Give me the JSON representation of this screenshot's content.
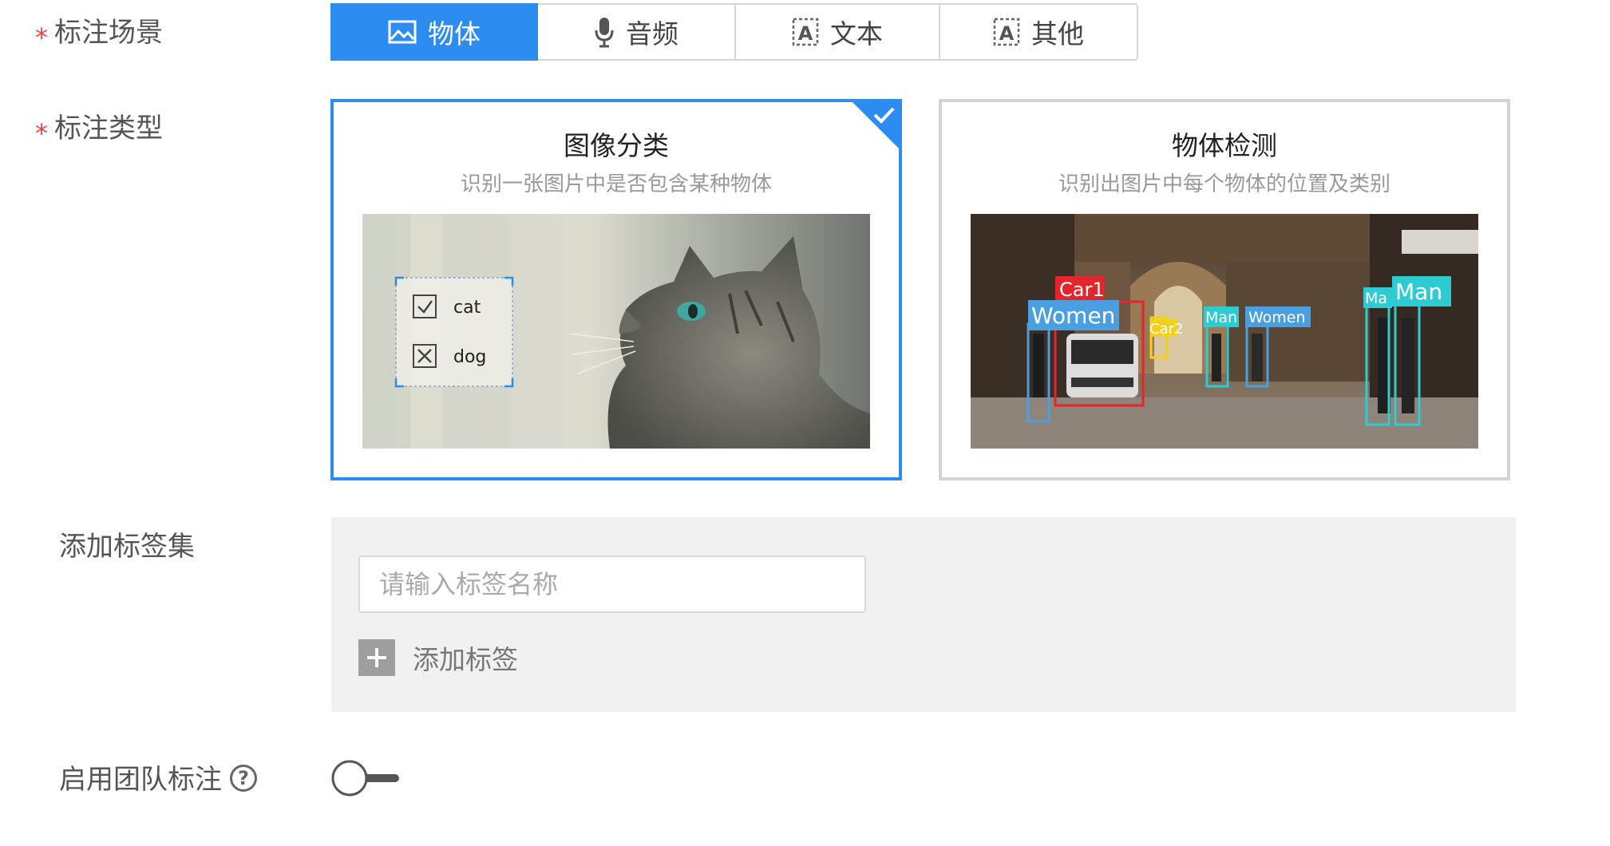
{
  "scene": {
    "label": "标注场景",
    "options": [
      {
        "label": "物体",
        "icon": "image-icon",
        "active": true
      },
      {
        "label": "音频",
        "icon": "microphone-icon",
        "active": false
      },
      {
        "label": "文本",
        "icon": "text-icon",
        "active": false
      },
      {
        "label": "其他",
        "icon": "text-icon",
        "active": false
      }
    ]
  },
  "type": {
    "label": "标注类型",
    "cards": [
      {
        "title": "图像分类",
        "desc": "识别一张图片中是否包含某种物体",
        "selected": true,
        "options": [
          {
            "label": "cat",
            "state": "checked"
          },
          {
            "label": "dog",
            "state": "crossed"
          }
        ]
      },
      {
        "title": "物体检测",
        "desc": "识别出图片中每个物体的位置及类别",
        "selected": false,
        "boxes": [
          "Car1",
          "Women",
          "Car2",
          "Man",
          "Women",
          "Ma",
          "Man"
        ]
      }
    ]
  },
  "tagset": {
    "label": "添加标签集",
    "placeholder": "请输入标签名称",
    "value": "",
    "add_label": "添加标签"
  },
  "team": {
    "label": "启用团队标注",
    "help_symbol": "?",
    "enabled": false
  },
  "colors": {
    "accent": "#2d8cf0",
    "required": "#e64545",
    "panel_bg": "#f2f1f1"
  }
}
